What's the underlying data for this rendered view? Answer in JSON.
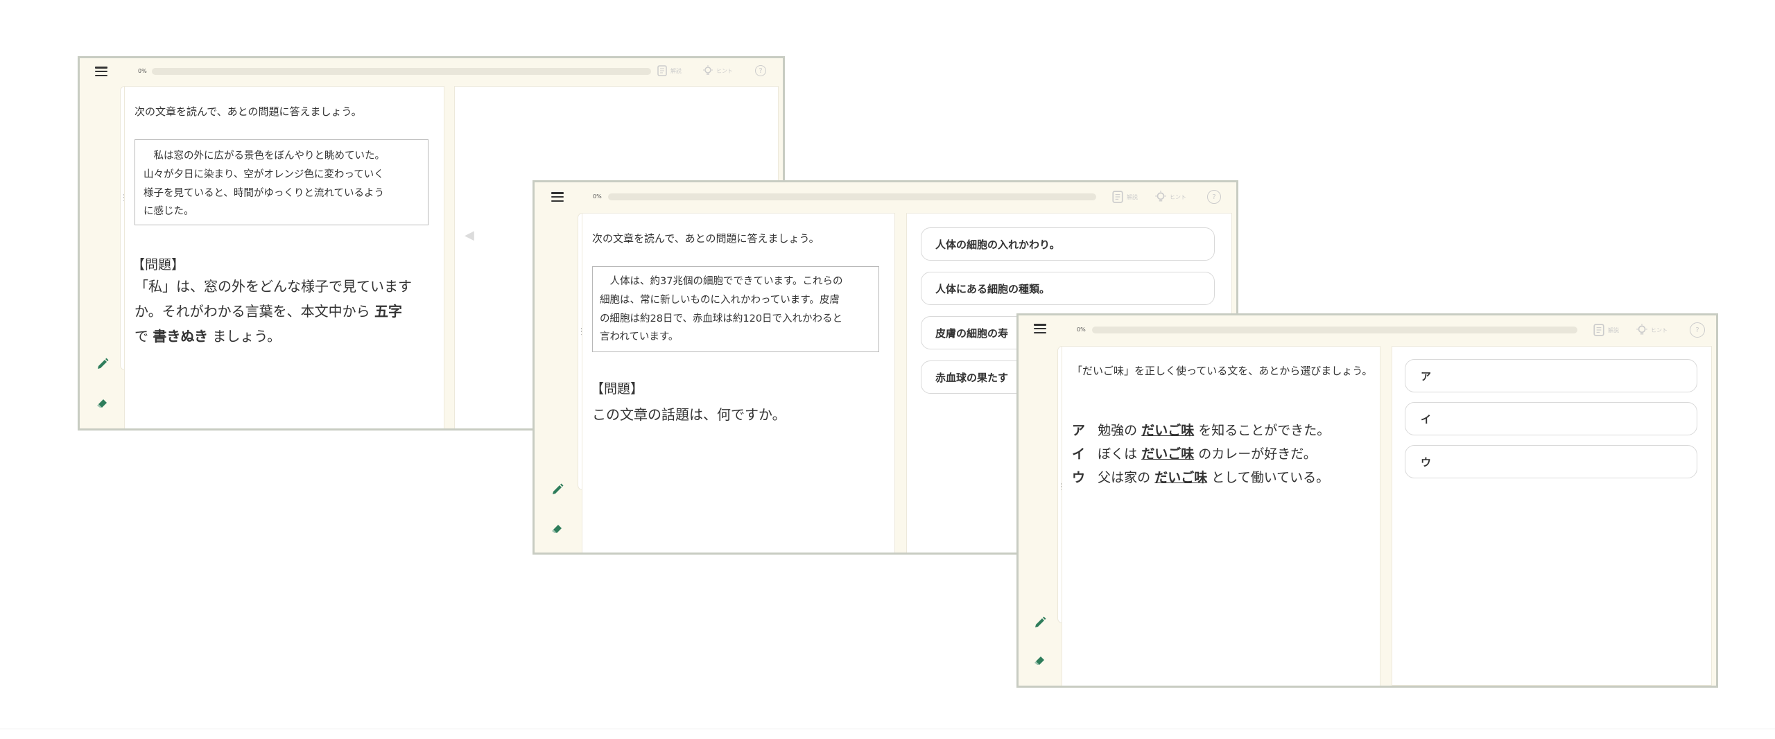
{
  "colors": {
    "accent": "#2e7d5b",
    "border": "#c8ccc2",
    "background": "#fbf8ec"
  },
  "common": {
    "progress_label": "0%",
    "explain_label": "解説",
    "hint_label": "ヒント",
    "help_label": "?",
    "progress_value": 0
  },
  "panel1": {
    "instruction": "次の文章を読んで、あとの問題に答えましょう。",
    "passage_lines": [
      "私は窓の外に広がる景色をぼんやりと眺めていた。",
      "山々が夕日に染まり、空がオレンジ色に変わっていく",
      "様子を見ていると、時間がゆっくりと流れているよう",
      "に感じた。"
    ],
    "question_heading": "【問題】",
    "question_lines": [
      "「私」は、窓の外をどんな様子で見ています",
      "か。それがわかる言葉を、本文中から"
    ],
    "question_emph1": "五字",
    "question_end_pre": "で",
    "question_emph2": "書きぬき",
    "question_end_post": "ましょう。"
  },
  "panel2": {
    "instruction": "次の文章を読んで、あとの問題に答えましょう。",
    "passage_lines": [
      "人体は、約37兆個の細胞でできています。これらの",
      "細胞は、常に新しいものに入れかわっています。皮膚",
      "の細胞は約28日で、赤血球は約120日で入れかわると",
      "言われています。"
    ],
    "question_heading": "【問題】",
    "question_text": "この文章の話題は、何ですか。",
    "options": [
      "人体の細胞の入れかわり。",
      "人体にある細胞の種類。",
      "皮膚の細胞の寿",
      "赤血球の果たす"
    ]
  },
  "panel3": {
    "instruction": "「だいご味」を正しく使っている文を、あとから選びましょう。",
    "choices": [
      {
        "letter": "ア",
        "pre": "勉強の",
        "emph": "だいご味",
        "post": "を知ることができた。"
      },
      {
        "letter": "イ",
        "pre": "ぼくは",
        "emph": "だいご味",
        "post": "のカレーが好きだ。"
      },
      {
        "letter": "ウ",
        "pre": "父は家の",
        "emph": "だいご味",
        "post": "として働いている。"
      }
    ],
    "options": [
      "ア",
      "イ",
      "ウ"
    ]
  }
}
